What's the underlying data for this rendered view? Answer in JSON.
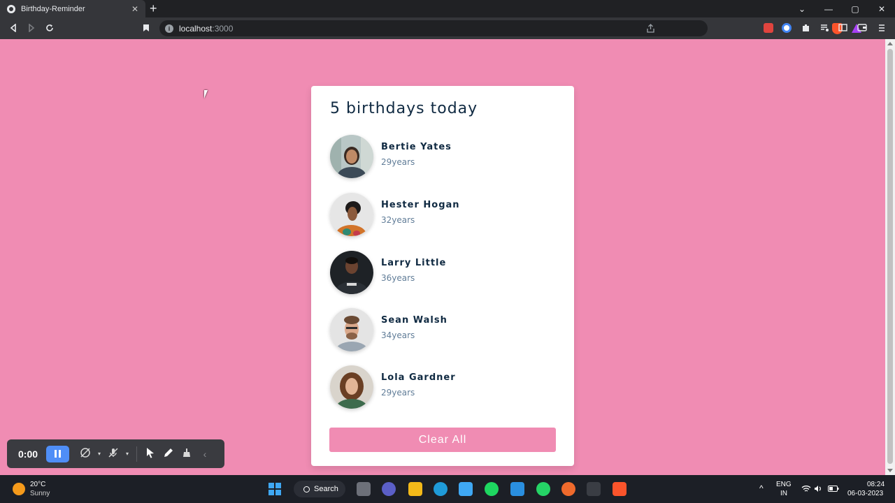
{
  "browser": {
    "tab_title": "Birthday-Reminder",
    "tab_close": "✕",
    "new_tab": "+",
    "url_host": "localhost",
    "url_port": ":3000",
    "window_controls": [
      "⌄",
      "—",
      "▢",
      "✕"
    ]
  },
  "app": {
    "title": "5 birthdays today",
    "people": [
      {
        "name": "Bertie Yates",
        "age": "29years"
      },
      {
        "name": "Hester Hogan",
        "age": "32years"
      },
      {
        "name": "Larry Little",
        "age": "36years"
      },
      {
        "name": "Sean Walsh",
        "age": "34years"
      },
      {
        "name": "Lola Gardner",
        "age": "29years"
      }
    ],
    "clear_button": "Clear All",
    "background_color": "#f08cb3",
    "primary_text_color": "#102a42",
    "secondary_text_color": "#617d98"
  },
  "recorder": {
    "time": "0:00"
  },
  "taskbar": {
    "temperature": "20°C",
    "condition": "Sunny",
    "search_label": "Search",
    "language_1": "ENG",
    "language_2": "IN",
    "clock_time": "08:24",
    "clock_date": "06-03-2023"
  }
}
